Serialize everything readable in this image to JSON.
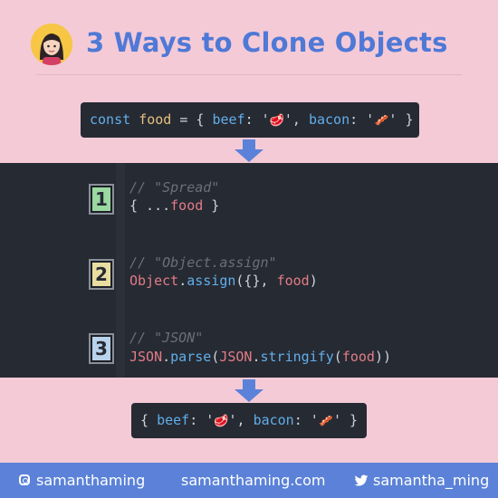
{
  "header": {
    "title": "3 Ways to Clone Objects"
  },
  "source": {
    "kw_const": "const",
    "var": "food",
    "eq_open": " = { ",
    "k1": "beef",
    "colon1": ": '",
    "e1": "🥩",
    "sep": "', ",
    "k2": "bacon",
    "colon2": ": '",
    "e2": "🥓",
    "close": "' }"
  },
  "methods": [
    {
      "number": "1",
      "comment": "// \"Spread\"",
      "code_open": "{ ...",
      "code_var": "food",
      "code_close": " }"
    },
    {
      "number": "2",
      "comment": "// \"Object.assign\"",
      "obj": "Object",
      "dot": ".",
      "fn": "assign",
      "args_open": "({}, ",
      "arg": "food",
      "args_close": ")"
    },
    {
      "number": "3",
      "comment": "// \"JSON\"",
      "json1": "JSON",
      "dot1": ".",
      "fn1": "parse",
      "p1": "(",
      "json2": "JSON",
      "dot2": ".",
      "fn2": "stringify",
      "p2": "(",
      "arg": "food",
      "p3": "))"
    }
  ],
  "result": {
    "open": "{ ",
    "k1": "beef",
    "colon1": ": '",
    "e1": "🥩",
    "sep": "', ",
    "k2": "bacon",
    "colon2": ": '",
    "e2": "🥓",
    "close": "' }"
  },
  "footer": {
    "instagram": "samanthaming",
    "website": "samanthaming.com",
    "twitter": "samantha_ming"
  },
  "colors": {
    "background": "#f4cad7",
    "accent": "#5b82d8",
    "code_bg": "#262a33"
  }
}
